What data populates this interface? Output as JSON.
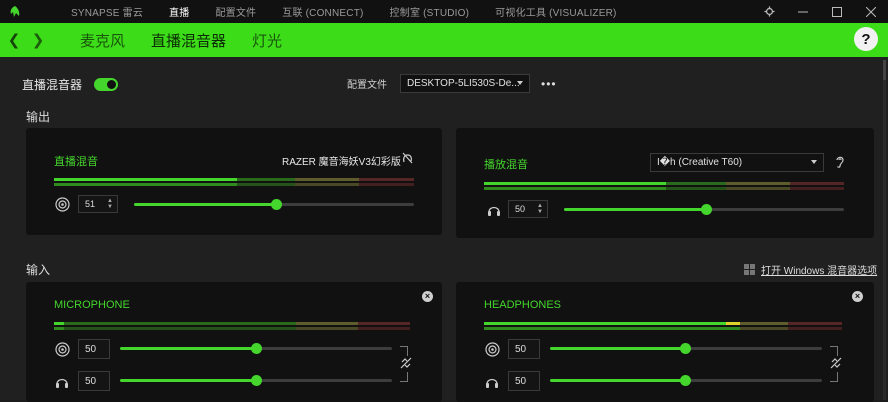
{
  "titlebar": {
    "nav": [
      "SYNAPSE 雷云",
      "直播",
      "配置文件",
      "互联 (CONNECT)",
      "控制室 (STUDIO)",
      "可视化工具 (VISUALIZER)"
    ],
    "active_index": 1
  },
  "subnav": {
    "tabs": [
      "麦克风",
      "直播混音器",
      "灯光"
    ],
    "active_index": 1
  },
  "mixer": {
    "title": "直播混音器",
    "enabled": true,
    "profile_label": "配置文件",
    "profile_value": "DESKTOP-5LI530S-De..."
  },
  "output": {
    "section_label": "输出",
    "stream_mix": {
      "title": "直播混音",
      "device": "RAZER 魔音海妖V3幻彩版",
      "volume": "51",
      "level": 0.51
    },
    "playback_mix": {
      "title": "播放混音",
      "device": "I�h (Creative T60)",
      "volume": "50",
      "level": 0.5
    }
  },
  "input": {
    "section_label": "输入",
    "windows_link": "打开 Windows 混音器选项",
    "microphone": {
      "title": "MICROPHONE",
      "stream_volume": "50",
      "monitor_volume": "50",
      "stream_level": 0.5,
      "monitor_level": 0.5
    },
    "headphones": {
      "title": "HEADPHONES",
      "stream_volume": "50",
      "monitor_volume": "50",
      "stream_level": 0.5,
      "monitor_level": 0.5
    }
  },
  "colors": {
    "accent": "#44d62c",
    "banner": "#3cdd18",
    "meter_yellow": "#6c6a33",
    "meter_red": "#5a2a2a"
  }
}
